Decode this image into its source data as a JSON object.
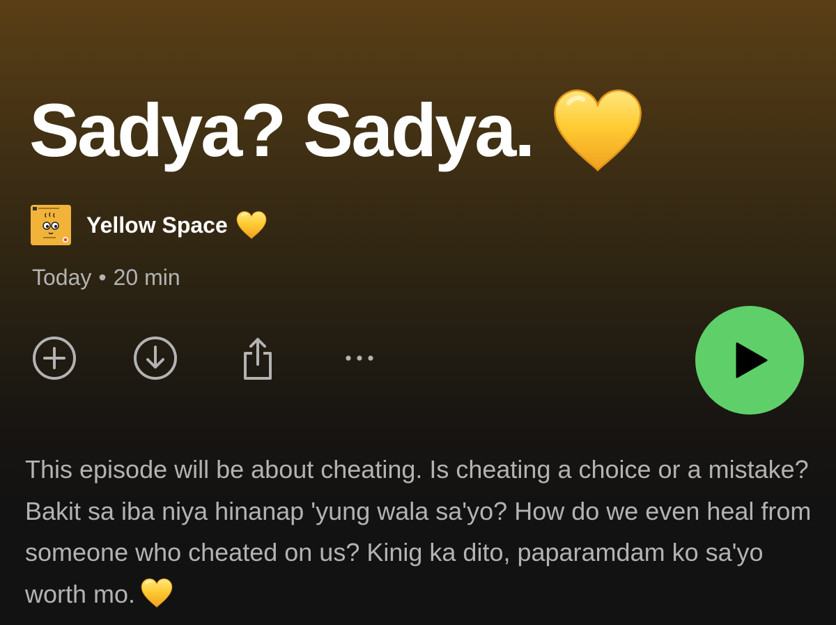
{
  "episode": {
    "title": "Sadya? Sadya.",
    "title_emoji": "yellow-heart-icon"
  },
  "show": {
    "name": "Yellow Space",
    "name_emoji": "yellow-heart-icon",
    "cover_icon": "podcast-cover-art"
  },
  "meta": {
    "date": "Today",
    "separator": "•",
    "duration": "20 min"
  },
  "actions": {
    "add_icon": "add-circle-icon",
    "download_icon": "download-circle-icon",
    "share_icon": "share-icon",
    "more_icon": "more-options-icon",
    "play_icon": "play-icon"
  },
  "description": {
    "text": "This episode will be about cheating. Is cheating a choice or a mistake? Bakit sa iba niya hinanap 'yung wala sa'yo? How do we even heal from someone who cheated on us? Kinig ka dito, paparamdam ko sa'yo worth mo.",
    "trailing_emoji": "yellow-heart-icon"
  },
  "colors": {
    "accent_green": "#5fd069",
    "heart_yellow": "#ffcc33",
    "secondary_text": "#b3b3b3",
    "background_top": "#5a3f16",
    "background_bottom": "#121212"
  }
}
